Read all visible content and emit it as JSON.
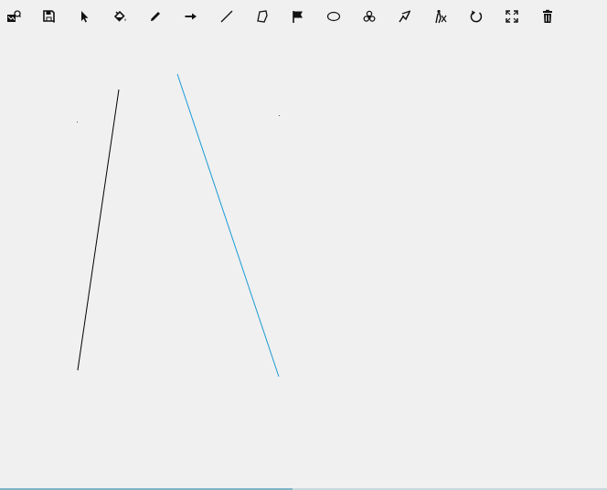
{
  "toolbar": {
    "tools": [
      {
        "id": "open",
        "icon": "open-image-icon"
      },
      {
        "id": "save",
        "icon": "save-icon"
      },
      {
        "id": "select",
        "icon": "pointer-icon"
      },
      {
        "id": "fill",
        "icon": "paint-bucket-icon"
      },
      {
        "id": "pencil",
        "icon": "pencil-icon"
      },
      {
        "id": "arrow",
        "icon": "arrow-right-icon"
      },
      {
        "id": "line",
        "icon": "line-icon"
      },
      {
        "id": "polygon",
        "icon": "polygon-icon"
      },
      {
        "id": "flag",
        "icon": "flag-icon"
      },
      {
        "id": "ellipse",
        "icon": "ellipse-icon"
      },
      {
        "id": "biohazard",
        "icon": "biohazard-icon"
      },
      {
        "id": "path",
        "icon": "path-icon"
      },
      {
        "id": "person",
        "icon": "person-icon"
      },
      {
        "id": "undo",
        "icon": "undo-icon"
      },
      {
        "id": "fullscreen",
        "icon": "fullscreen-icon"
      },
      {
        "id": "delete",
        "icon": "trash-icon"
      }
    ]
  },
  "canvas": {
    "stroke_colors": {
      "black": "#000000",
      "blue": "#1a9ad6"
    }
  }
}
